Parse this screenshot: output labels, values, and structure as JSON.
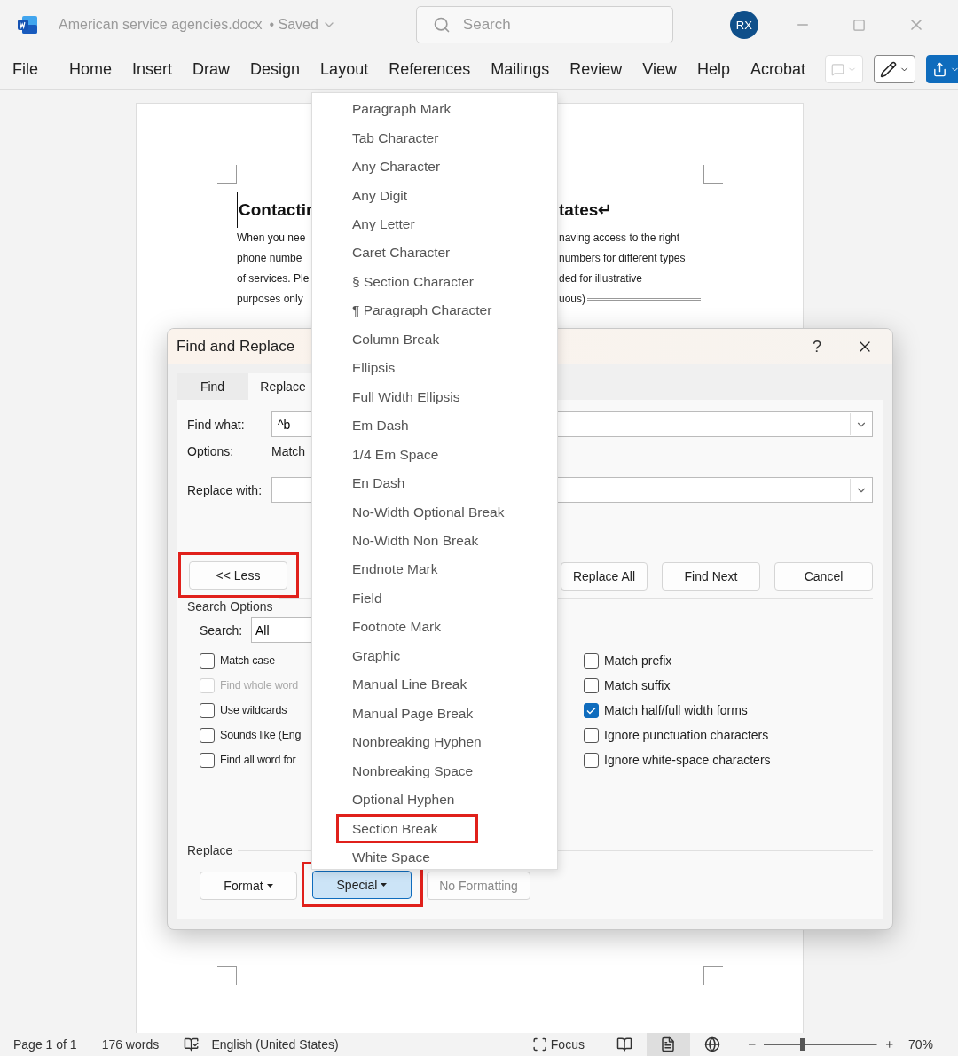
{
  "app": {
    "title": "American service agencies.docx",
    "save_status": "• Saved",
    "search_placeholder": "Search",
    "user_initials": "RX"
  },
  "ribbon": {
    "tabs": [
      "File",
      "Home",
      "Insert",
      "Draw",
      "Design",
      "Layout",
      "References",
      "Mailings",
      "Review",
      "View",
      "Help",
      "Acrobat"
    ]
  },
  "document": {
    "heading": {
      "left": "Contactir",
      "right": "tates↵"
    },
    "lines": [
      {
        "left": "When you nee",
        "right": "naving access to the right",
        "section_break": false
      },
      {
        "left": "phone numbe",
        "right": "numbers for different types",
        "section_break": false
      },
      {
        "left": "of services. Ple",
        "right": "ded for illustrative",
        "section_break": false
      },
      {
        "left": "purposes only",
        "right": "uous)",
        "section_break": true
      }
    ]
  },
  "dialog": {
    "title": "Find and Replace",
    "help": "?",
    "tabs": [
      {
        "label": "Find",
        "selected": false
      },
      {
        "label": "Replace",
        "selected": true
      }
    ],
    "find_what": {
      "label": "Find what:",
      "value": "^b"
    },
    "options": {
      "label": "Options:",
      "value": "Match"
    },
    "replace_with": {
      "label": "Replace with:"
    },
    "less_button": {
      "label": "<< Less",
      "annotated": true
    },
    "action_buttons": [
      "Replace All",
      "Find Next",
      "Cancel"
    ],
    "search_options": {
      "title": "Search Options",
      "search_label": "Search:",
      "search_value": "All",
      "left_checks": [
        {
          "label": "Match case",
          "checked": false,
          "disabled": false
        },
        {
          "label": "Find whole word",
          "checked": false,
          "disabled": true
        },
        {
          "label": "Use wildcards",
          "checked": false,
          "disabled": false
        },
        {
          "label": "Sounds like (Eng",
          "checked": false,
          "disabled": false
        },
        {
          "label": "Find all word for",
          "checked": false,
          "disabled": false
        }
      ],
      "right_checks": [
        {
          "label": "Match prefix",
          "checked": false,
          "disabled": false
        },
        {
          "label": "Match suffix",
          "checked": false,
          "disabled": false
        },
        {
          "label": "Match half/full width forms",
          "checked": true,
          "disabled": false
        },
        {
          "label": "Ignore punctuation characters",
          "checked": false,
          "disabled": false
        },
        {
          "label": "Ignore white-space characters",
          "checked": false,
          "disabled": false
        }
      ]
    },
    "replace_section": {
      "title": "Replace",
      "buttons": [
        {
          "label": "Format",
          "kind": "dropdown",
          "pressed": false,
          "disabled": false,
          "annotated": false
        },
        {
          "label": "Special",
          "kind": "dropdown",
          "pressed": true,
          "disabled": false,
          "annotated": true
        },
        {
          "label": "No Formatting",
          "kind": "plain",
          "pressed": false,
          "disabled": true,
          "annotated": false
        }
      ]
    }
  },
  "special_menu": {
    "items": [
      {
        "label": "Paragraph Mark",
        "annotated": false
      },
      {
        "label": "Tab Character",
        "annotated": false
      },
      {
        "label": "Any Character",
        "annotated": false
      },
      {
        "label": "Any Digit",
        "annotated": false
      },
      {
        "label": "Any Letter",
        "annotated": false
      },
      {
        "label": "Caret Character",
        "annotated": false
      },
      {
        "label": "§ Section Character",
        "annotated": false
      },
      {
        "label": "¶ Paragraph Character",
        "annotated": false
      },
      {
        "label": "Column Break",
        "annotated": false
      },
      {
        "label": "Ellipsis",
        "annotated": false
      },
      {
        "label": "Full Width Ellipsis",
        "annotated": false
      },
      {
        "label": "Em Dash",
        "annotated": false
      },
      {
        "label": "1/4 Em Space",
        "annotated": false
      },
      {
        "label": "En Dash",
        "annotated": false
      },
      {
        "label": "No-Width Optional Break",
        "annotated": false
      },
      {
        "label": "No-Width Non Break",
        "annotated": false
      },
      {
        "label": "Endnote Mark",
        "annotated": false
      },
      {
        "label": "Field",
        "annotated": false
      },
      {
        "label": "Footnote Mark",
        "annotated": false
      },
      {
        "label": "Graphic",
        "annotated": false
      },
      {
        "label": "Manual Line Break",
        "annotated": false
      },
      {
        "label": "Manual Page Break",
        "annotated": false
      },
      {
        "label": "Nonbreaking Hyphen",
        "annotated": false
      },
      {
        "label": "Nonbreaking Space",
        "annotated": false
      },
      {
        "label": "Optional Hyphen",
        "annotated": false
      },
      {
        "label": "Section Break",
        "annotated": true
      },
      {
        "label": "White Space",
        "annotated": false
      }
    ]
  },
  "status_bar": {
    "page": "Page 1 of 1",
    "words": "176 words",
    "language": "English (United States)",
    "focus": "Focus",
    "views": [
      {
        "kind": "read",
        "selected": false
      },
      {
        "kind": "print",
        "selected": true
      },
      {
        "kind": "web",
        "selected": false
      }
    ],
    "zoom": {
      "level": 0.34,
      "label": "70%"
    }
  }
}
